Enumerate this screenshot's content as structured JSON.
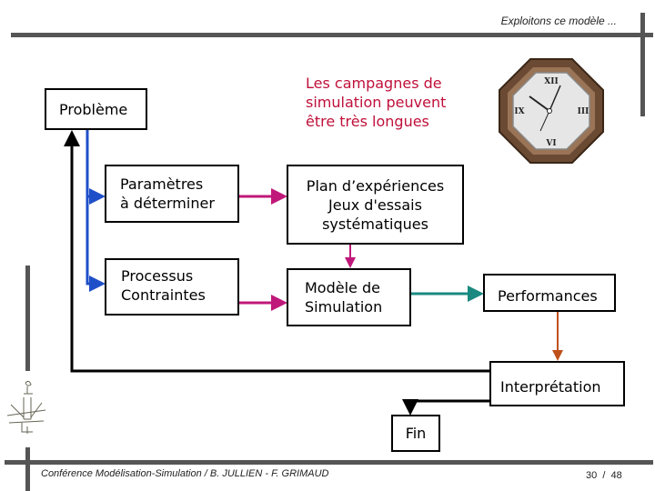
{
  "header": {
    "title": "Exploitons ce modèle ..."
  },
  "note": {
    "lines": [
      "Les campagnes de",
      "simulation peuvent",
      "être très longues"
    ],
    "color": "#c0103a"
  },
  "boxes": {
    "probleme": [
      "Problème"
    ],
    "parametres": [
      "Paramètres",
      "à déterminer"
    ],
    "processus": [
      "Processus",
      "Contraintes"
    ],
    "plan": [
      "Plan d’expériences",
      "Jeux d'essais",
      "systématiques"
    ],
    "modele": [
      "Modèle de",
      "Simulation"
    ],
    "performances": [
      "Performances"
    ],
    "interpretation": [
      "Interprétation"
    ],
    "fin": [
      "Fin"
    ]
  },
  "colors": {
    "blue": "#1f4fc8",
    "magenta": "#c0187a",
    "teal": "#1a8a80",
    "orange": "#c0501a",
    "bars": "#555555"
  },
  "icons": {
    "clock": "clock-icon",
    "logo": "logo-figure-icon"
  },
  "footer": {
    "text": "Conférence Modélisation-Simulation / B. JULLIEN - F. GRIMAUD",
    "page": "30  /  48"
  }
}
